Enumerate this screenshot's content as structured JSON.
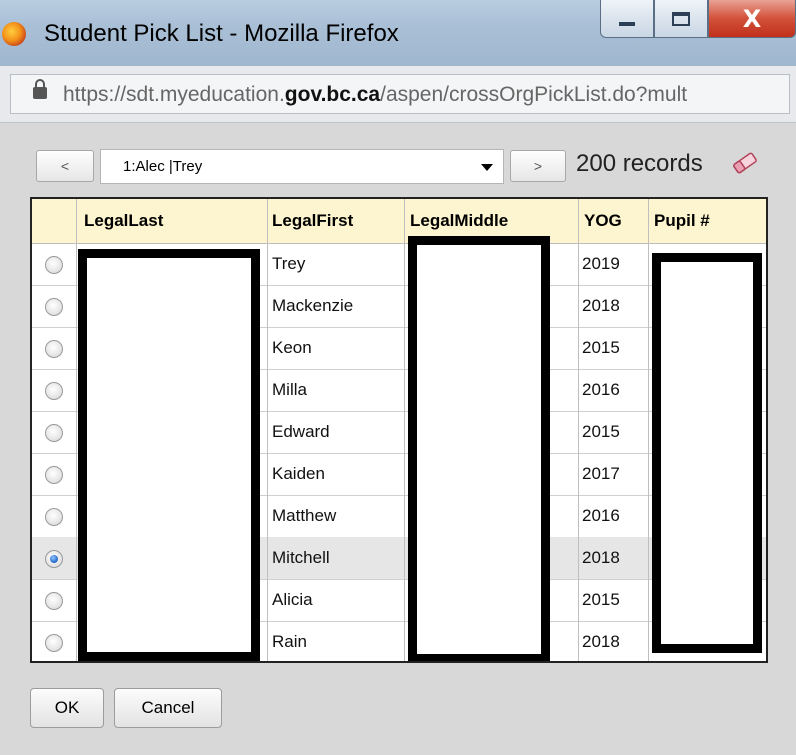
{
  "window": {
    "title": "Student Pick List - Mozilla Firefox",
    "close_label": "X"
  },
  "urlbar": {
    "url_pre": "https://sdt.myeducation.",
    "url_domain": "gov.bc.ca",
    "url_post": "/aspen/crossOrgPickList.do?mult"
  },
  "toolbar": {
    "prev_label": "<",
    "next_label": ">",
    "selected_option": "1:Alec |Trey",
    "records_text": "200 records"
  },
  "table": {
    "headers": [
      "LegalLast",
      "LegalFirst",
      "LegalMiddle",
      "YOG",
      "Pupil #"
    ],
    "rows": [
      {
        "first": "Trey",
        "yog": "2019",
        "selected": false
      },
      {
        "first": "Mackenzie",
        "yog": "2018",
        "selected": false
      },
      {
        "first": "Keon",
        "yog": "2015",
        "selected": false
      },
      {
        "first": "Milla",
        "yog": "2016",
        "selected": false
      },
      {
        "first": "Edward",
        "yog": "2015",
        "selected": false
      },
      {
        "first": "Kaiden",
        "yog": "2017",
        "selected": false
      },
      {
        "first": "Matthew",
        "yog": "2016",
        "selected": false
      },
      {
        "first": "Mitchell",
        "yog": "2018",
        "selected": true
      },
      {
        "first": "Alicia",
        "yog": "2015",
        "selected": false
      },
      {
        "first": "Rain",
        "yog": "2018",
        "selected": false
      }
    ]
  },
  "buttons": {
    "ok_label": "OK",
    "cancel_label": "Cancel"
  },
  "colors": {
    "header_bg": "#fdf5cf",
    "selected_row_bg": "#e6e6e6",
    "close_button": "#c1301b"
  }
}
